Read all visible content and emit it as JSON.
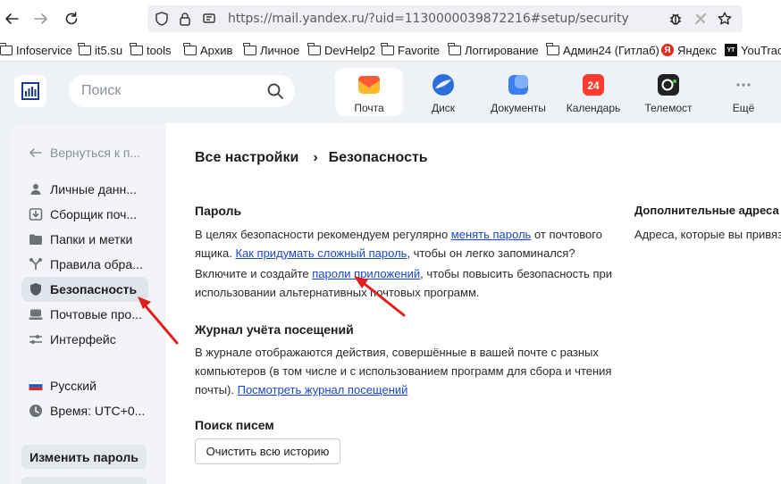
{
  "browser": {
    "url": "https://mail.yandex.ru/?uid=1130000039872216#setup/security"
  },
  "bookmarks": [
    {
      "label": "Infoservice",
      "icon": "folder-icon"
    },
    {
      "label": "it5.su",
      "icon": "folder-icon"
    },
    {
      "label": "tools",
      "icon": "folder-icon"
    },
    {
      "label": "Архив",
      "icon": "folder-icon"
    },
    {
      "label": "Личное",
      "icon": "folder-icon"
    },
    {
      "label": "DevHelp2",
      "icon": "folder-icon"
    },
    {
      "label": "Favorite",
      "icon": "folder-icon"
    },
    {
      "label": "Логгирование",
      "icon": "folder-icon"
    },
    {
      "label": "Админ24 (Гитлаб)",
      "icon": "folder-icon"
    },
    {
      "label": "Яндекс",
      "icon": "yandex-icon"
    },
    {
      "label": "YouTrack",
      "icon": "youtrack-icon"
    }
  ],
  "header": {
    "search_placeholder": "Поиск",
    "services": [
      {
        "label": "Почта",
        "active": true
      },
      {
        "label": "Диск",
        "active": false
      },
      {
        "label": "Документы",
        "active": false
      },
      {
        "label": "Календарь",
        "active": false,
        "badge": "24"
      },
      {
        "label": "Телемост",
        "active": false
      },
      {
        "label": "Ещё",
        "active": false
      }
    ]
  },
  "sidebar": {
    "back": "Вернуться к п...",
    "items": [
      {
        "label": "Личные данн...",
        "icon": "person-icon"
      },
      {
        "label": "Сборщик поч...",
        "icon": "collector-icon"
      },
      {
        "label": "Папки и метки",
        "icon": "folder-icon"
      },
      {
        "label": "Правила обра...",
        "icon": "rules-icon"
      },
      {
        "label": "Безопасность",
        "icon": "shield-icon",
        "active": true
      },
      {
        "label": "Почтовые про...",
        "icon": "mail-programs-icon"
      },
      {
        "label": "Интерфейс",
        "icon": "sliders-icon"
      }
    ],
    "language": "Русский",
    "timezone": "Время: UTC+0...",
    "change_password": "Изменить пароль"
  },
  "main": {
    "breadcrumb_root": "Все настройки",
    "breadcrumb_sep": "›",
    "breadcrumb_current": "Безопасность",
    "password": {
      "title": "Пароль",
      "p1_a": "В целях безопасности рекомендуем регулярно ",
      "p1_link": "менять пароль",
      "p1_b": " от почтового ящика. ",
      "p1_link2": "Как придумать сложный пароль",
      "p1_c": ", чтобы он легко запоминался?",
      "p2_a": "Включите и создайте ",
      "p2_link": "пароли приложений",
      "p2_b": ", чтобы повысить безопасность при использовании альтернативных почтовых программ."
    },
    "journal": {
      "title": "Журнал учёта посещений",
      "text": "В журнале отображаются действия, совершённые в вашей почте с разных компьютеров (в том числе и с использованием программ для сбора и чтения почты). ",
      "link": "Посмотреть журнал посещений"
    },
    "search_letters": {
      "title": "Поиск писем",
      "button": "Очистить всю историю"
    },
    "additional": {
      "title": "Дополнительные адреса",
      "text": "Адреса, которые вы привяз"
    }
  },
  "annotation_color": "#e0201c"
}
